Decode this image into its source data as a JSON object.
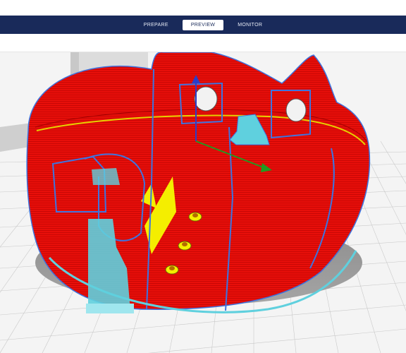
{
  "stages": [
    {
      "label": "PREPARE",
      "active": false
    },
    {
      "label": "PREVIEW",
      "active": true
    },
    {
      "label": "MONITOR",
      "active": false
    }
  ],
  "scene": {
    "model_color": "#e80f0a",
    "outline_color": "#3d74e0",
    "support_color": "#5fd0de",
    "gizmo_axes": [
      "y-axis-arrow",
      "x-axis-arrow"
    ]
  }
}
